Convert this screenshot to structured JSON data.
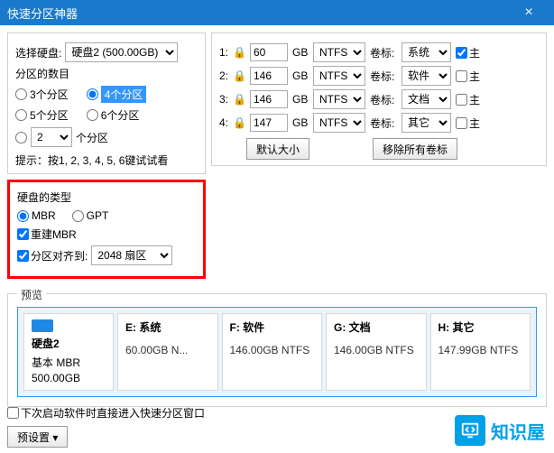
{
  "title": "快速分区神器",
  "left": {
    "disk_label": "选择硬盘:",
    "disk_value": "硬盘2 (500.00GB)",
    "count_label": "分区的数目",
    "r3": "3个分区",
    "r4": "4个分区",
    "r5": "5个分区",
    "r6": "6个分区",
    "custom_count": "2",
    "custom_suffix": "个分区",
    "tip": "提示：按1, 2, 3, 4, 5, 6键试试看"
  },
  "redbox": {
    "hdr": "硬盘的类型",
    "mbr": "MBR",
    "gpt": "GPT",
    "rebuild": "重建MBR",
    "align": "分区对齐到:",
    "align_val": "2048 扇区"
  },
  "parts": {
    "gb": "GB",
    "vollabel": "卷标:",
    "primary": "主",
    "rows": [
      {
        "n": "1:",
        "size": "60",
        "fs": "NTFS",
        "vol": "系统",
        "locked": true,
        "primary": true
      },
      {
        "n": "2:",
        "size": "146",
        "fs": "NTFS",
        "vol": "软件",
        "locked": true,
        "primary": false
      },
      {
        "n": "3:",
        "size": "146",
        "fs": "NTFS",
        "vol": "文档",
        "locked": true,
        "primary": false
      },
      {
        "n": "4:",
        "size": "147",
        "fs": "NTFS",
        "vol": "其它",
        "locked": true,
        "primary": false
      }
    ],
    "btn_default": "默认大小",
    "btn_clear": "移除所有卷标"
  },
  "preview": {
    "legend": "预览",
    "disk_name": "硬盘2",
    "disk_type": "基本 MBR",
    "disk_size": "500.00GB",
    "items": [
      {
        "t": "E: 系统",
        "s": "60.00GB N..."
      },
      {
        "t": "F: 软件",
        "s": "146.00GB NTFS"
      },
      {
        "t": "G: 文档",
        "s": "146.00GB NTFS"
      },
      {
        "t": "H: 其它",
        "s": "147.99GB NTFS"
      }
    ]
  },
  "bottom": {
    "chk": "下次启动软件时直接进入快速分区窗口",
    "preset": "预设置"
  },
  "logo": "知识屋"
}
